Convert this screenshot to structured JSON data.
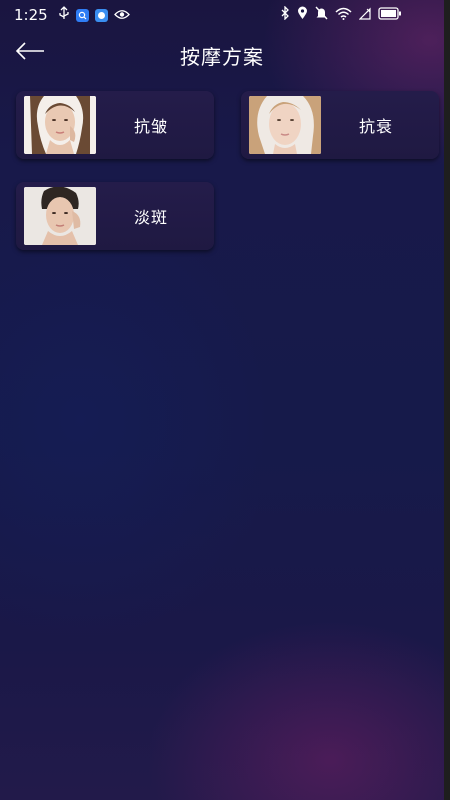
{
  "status_bar": {
    "time": "1:25",
    "icons": [
      "usb-icon",
      "app-badge-search",
      "app-badge-chat",
      "eye-icon",
      "bluetooth-icon",
      "location-icon",
      "mute-icon",
      "wifi-icon",
      "signal-icon",
      "battery-icon"
    ]
  },
  "header": {
    "title": "按摩方案",
    "back_icon": "arrow-left-icon"
  },
  "plans": [
    {
      "label": "抗皱"
    },
    {
      "label": "抗衰"
    },
    {
      "label": "淡斑"
    }
  ],
  "colors": {
    "background_top": "#1a1540",
    "background_mid": "#161a4a",
    "accent_glow": "#782a6e",
    "card_bg": "#241c4a",
    "text": "#ffffff"
  }
}
